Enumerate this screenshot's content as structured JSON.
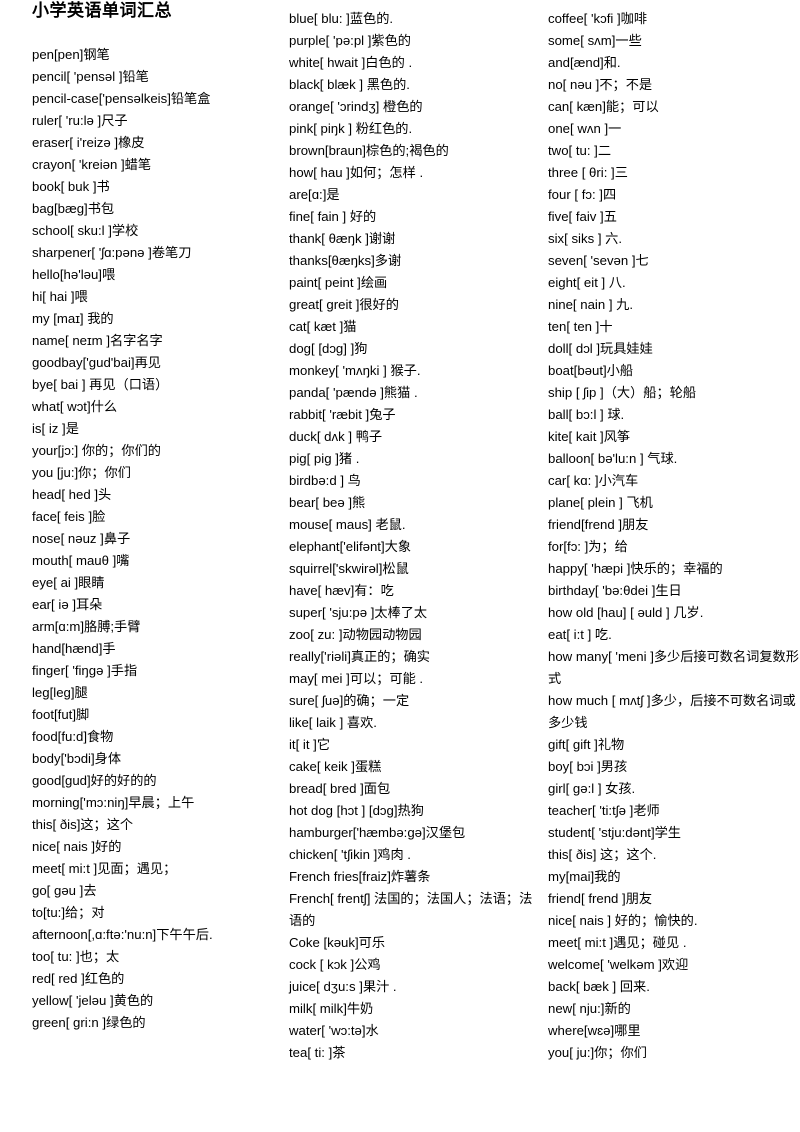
{
  "document": {
    "title": "小学英语单词汇总"
  },
  "columns": [
    {
      "id": "col-1",
      "entries": [
        "pen[pen]钢笔",
        "pencil[ 'pensəl ]铅笔",
        "pencil-case['pensəlkeis]铅笔盒",
        "ruler[ 'ru:lə ]尺子",
        "eraser[ i'reizə ]橡皮",
        "crayon[ 'kreiən ]蜡笔",
        "book[ buk ]书",
        "bag[bæg]书包",
        "school[ sku:l ]学校",
        "sharpener[ 'ʃɑ:pənə ]卷笔刀",
        "hello[hə'ləu]喂",
        "hi[ hai ]喂",
        "my [maɪ] 我的",
        "name[ neɪm ]名字名字",
        "goodbay['gud'bai]再见",
        "bye[ bai ] 再见（口语）",
        "what[ wɔt]什么",
        "is[ iz ]是",
        "your[jɔ:] 你的；你们的",
        "you [ju:]你；你们",
        "head[ hed ]头",
        "face[ feis ]脸",
        "nose[ nəuz ]鼻子",
        "mouth[ mauθ ]嘴",
        "eye[ ai ]眼睛",
        "ear[ iə ]耳朵",
        "arm[ɑ:m]胳膊;手臂",
        "hand[hænd]手",
        "finger[ 'fiŋgə ]手指",
        "leg[leg]腿",
        "foot[fut]脚",
        "food[fu:d]食物",
        "body['bɔdi]身体",
        "good[gud]好的好的的",
        "morning['mɔ:niŋ]早晨；上午",
        "this[ ðis]这；这个",
        "nice[ nais ]好的",
        "meet[ mi:t ]见面；遇见；",
        "go[ gəu ]去",
        "to[tu:]给；对",
        "afternoon[,ɑ:ftə:'nu:n]下午午后.",
        "too[ tu: ]也；太",
        "red[ red ]红色的",
        "yellow[ 'jeləu ]黄色的",
        "green[ gri:n ]绿色的"
      ]
    },
    {
      "id": "col-2",
      "entries": [
        "blue[ blu: ]蓝色的.",
        "purple[ 'pə:pl ]紫色的",
        "white[ hwait ]白色的 .",
        "black[ blæk ] 黑色的.",
        "orange[ 'ɔrindʒ] 橙色的",
        "pink[ piŋk ] 粉红色的.",
        "brown[braun]棕色的;褐色的",
        "how[ hau ]如何；怎样 .",
        "are[ɑ:]是",
        "fine[ fain ] 好的",
        "thank[ θæŋk ]谢谢",
        "thanks[θæŋks]多谢",
        "paint[ peint ]绘画",
        "great[ greit ]很好的",
        "cat[ kæt ]猫",
        "dog[ [dɔg] ]狗",
        "monkey[ 'mʌŋki ] 猴子.",
        "panda[ 'pændə ]熊猫 .",
        "rabbit[ 'ræbit ]兔子",
        "duck[ dʌk ] 鸭子",
        "pig[ pig ]猪 .",
        "birdbə:d ] 鸟",
        "bear[ beə ]熊",
        "mouse[ maus] 老鼠.",
        "elephant['elifənt]大象",
        "squirrel['skwirəl]松鼠",
        "have[ hæv]有：吃",
        "super[ 'sju:pə ]太棒了太",
        "zoo[ zu: ]动物园动物园",
        "really['riəli]真正的；确实",
        "may[ mei ]可以；可能 .",
        "sure[ ʃuə]的确；一定",
        "like[ laik ] 喜欢.",
        "it[ it ]它",
        "cake[ keik ]蛋糕",
        "bread[ bred ]面包",
        "hot dog [hɔt ] [dɔg]热狗",
        "hamburger['hæmbə:gə]汉堡包",
        "chicken[ 'tʃikin ]鸡肉 .",
        "French fries[fraiz]炸薯条",
        "French[ frentʃ] 法国的；法国人；法语；法语的",
        "Coke [kəuk]可乐",
        "cock [ kɔk ]公鸡",
        "juice[ dʒu:s ]果汁 .",
        "milk[ milk]牛奶",
        "water[ 'wɔ:tə]水",
        "tea[ ti: ]茶"
      ]
    },
    {
      "id": "col-3",
      "entries": [
        "coffee[ 'kɔfi ]咖啡",
        "some[ sʌm]一些",
        "and[ænd]和.",
        "no[ nəu ]不；不是",
        "can[ kæn]能；可以",
        "one[ wʌn ]一",
        "two[ tu: ]二",
        "three [ θri: ]三",
        "four [ fɔ: ]四",
        "five[ faiv ]五",
        "six[ siks ] 六.",
        "seven[ 'sevən ]七",
        "eight[ eit ] 八.",
        "nine[ nain ] 九.",
        "ten[ ten ]十",
        "doll[ dɔl ]玩具娃娃",
        "boat[bəut]小船",
        "ship [ ʃip ]（大）船；轮船",
        "ball[ bɔ:l ] 球.",
        "kite[ kait ]风筝",
        "balloon[ bə'lu:n ] 气球.",
        "car[ kɑ: ]小汽车",
        "plane[ plein ] 飞机",
        "friend[frend ]朋友",
        "for[fɔ: ]为；给",
        "happy[ 'hæpi ]快乐的；幸福的",
        "birthday[ 'bə:θdei ]生日",
        "how old [hau] [ əuld ] 几岁.",
        "eat[ i:t ] 吃.",
        "how many[ 'meni ]多少后接可数名词复数形式",
        "how much [ mʌtʃ ]多少，后接不可数名词或多少钱",
        "gift[ gift ]礼物",
        "boy[ bɔi ]男孩",
        "girl[ gə:l ] 女孩.",
        "teacher[ 'ti:tʃə ]老师",
        "student[ 'stju:dənt]学生",
        "this[ ðis] 这；这个.",
        "my[mai]我的",
        "friend[ frend ]朋友",
        "nice[ nais ] 好的；愉快的.",
        "meet[ mi:t ]遇见；碰见 .",
        "welcome[ 'welkəm ]欢迎",
        "back[ bæk ] 回来.",
        "new[ nju:]新的",
        "where[wɛə]哪里",
        "you[ ju:]你；你们"
      ]
    }
  ]
}
